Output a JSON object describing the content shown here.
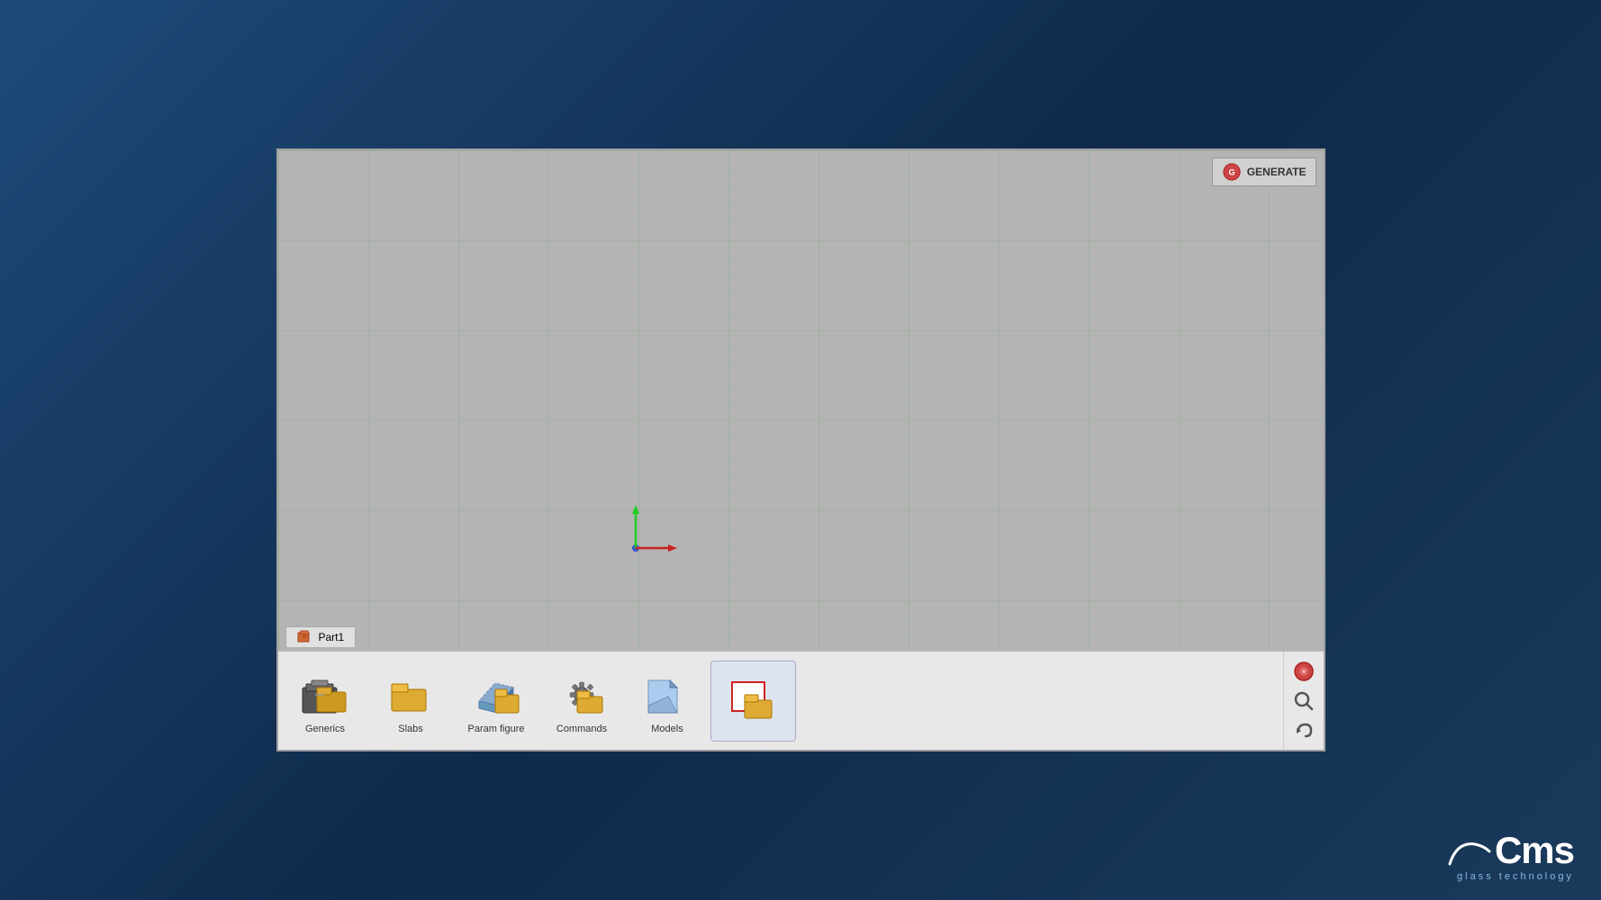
{
  "window": {
    "title": "CMS Glass Technology",
    "generate_label": "GENERATE"
  },
  "part_tab": {
    "label": "Part1"
  },
  "toolbar": {
    "items": [
      {
        "id": "generics",
        "label": "Generics"
      },
      {
        "id": "slabs",
        "label": "Slabs"
      },
      {
        "id": "param-figure",
        "label": "Param figure"
      },
      {
        "id": "commands",
        "label": "Commands"
      },
      {
        "id": "models",
        "label": "Models"
      },
      {
        "id": "extra",
        "label": ""
      }
    ]
  },
  "cms": {
    "name": "Cms",
    "tagline": "glass technology"
  }
}
